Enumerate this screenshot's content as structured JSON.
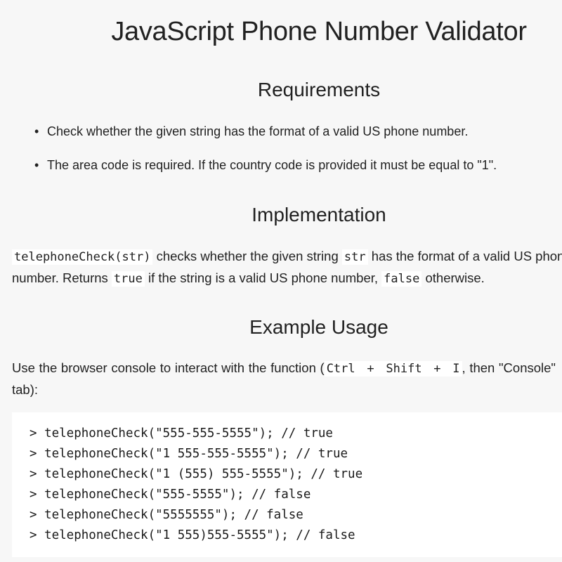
{
  "title": "JavaScript Phone Number Validator",
  "requirements": {
    "heading": "Requirements",
    "items": [
      "Check whether the given string has the format of a valid US phone number.",
      "The area code is required. If the country code is provided it must be equal to \"1\"."
    ]
  },
  "implementation": {
    "heading": "Implementation",
    "code_fn": "telephoneCheck(str)",
    "text1": " checks whether the given string ",
    "code_arg": "str",
    "text2": " has the format of a valid US phone number. Returns ",
    "code_true": "true",
    "text3": " if the string is a valid US phone number, ",
    "code_false": "false",
    "text4": " otherwise."
  },
  "usage": {
    "heading": "Example Usage",
    "text1": "Use the browser console to interact with the function (",
    "key_ctrl": "Ctrl",
    "plus": " + ",
    "key_shift": "Shift",
    "key_i": "I",
    "text2": ", then \"Console\" tab):",
    "code_lines": [
      "> telephoneCheck(\"555-555-5555\"); // true",
      "> telephoneCheck(\"1 555-555-5555\"); // true",
      "> telephoneCheck(\"1 (555) 555-5555\"); // true",
      "> telephoneCheck(\"555-5555\"); // false",
      "> telephoneCheck(\"5555555\"); // false",
      "> telephoneCheck(\"1 555)555-5555\"); // false"
    ]
  }
}
